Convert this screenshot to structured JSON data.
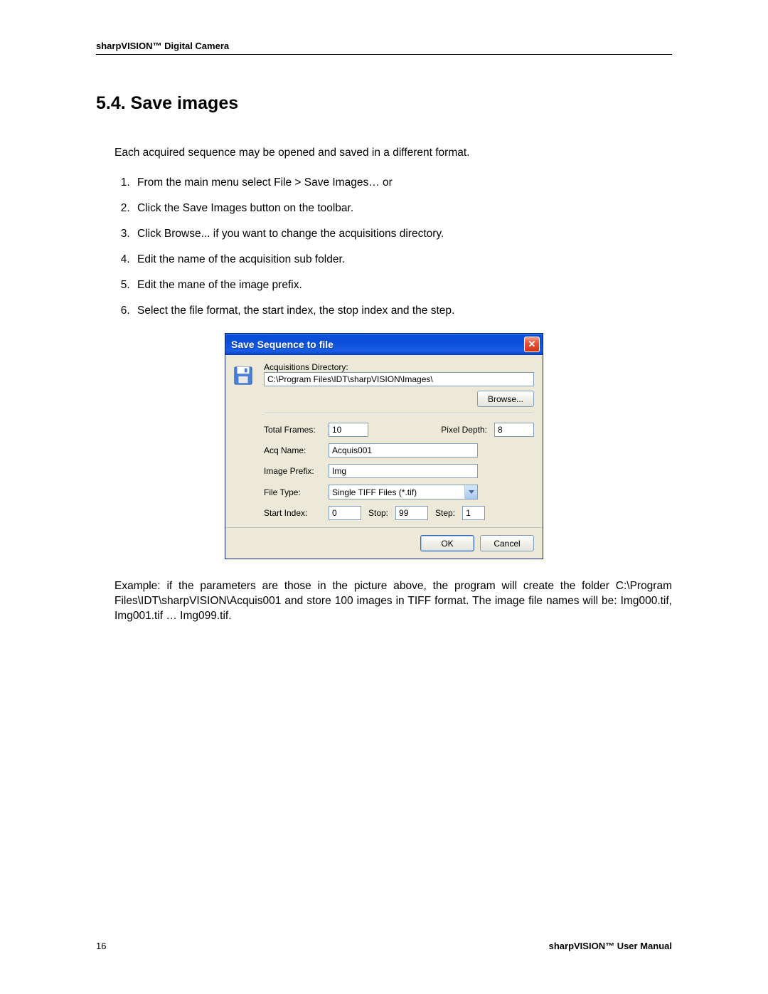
{
  "header": "sharpVISION™ Digital Camera",
  "heading": "5.4.  Save images",
  "intro": "Each acquired sequence may be opened and saved in a different format.",
  "steps": [
    "From the main menu select File > Save Images… or",
    "Click the Save Images button on the toolbar.",
    "Click Browse... if you want to change the acquisitions directory.",
    "Edit the name of the acquisition sub folder.",
    "Edit the mane of the image prefix.",
    "Select the file format, the start index, the stop index and the step."
  ],
  "dialog": {
    "title": "Save Sequence to file",
    "labels": {
      "acq_dir": "Acquisitions Directory:",
      "browse": "Browse...",
      "total_frames": "Total Frames:",
      "pixel_depth": "Pixel Depth:",
      "acq_name": "Acq Name:",
      "image_prefix": "Image Prefix:",
      "file_type": "File Type:",
      "start_index": "Start Index:",
      "stop": "Stop:",
      "step": "Step:",
      "ok": "OK",
      "cancel": "Cancel"
    },
    "values": {
      "acq_dir": "C:\\Program Files\\IDT\\sharpVISION\\Images\\",
      "total_frames": "10",
      "pixel_depth": "8",
      "acq_name": "Acquis001",
      "image_prefix": "Img",
      "file_type": "Single TIFF Files (*.tif)",
      "start_index": "0",
      "stop": "99",
      "step": "1"
    }
  },
  "example": "Example: if the parameters are those in the picture above, the program will create the folder C:\\Program Files\\IDT\\sharpVISION\\Acquis001 and store 100 images in TIFF format. The image file names will be: Img000.tif, Img001.tif … Img099.tif.",
  "footer": {
    "page": "16",
    "right": "sharpVISION™ User Manual"
  }
}
